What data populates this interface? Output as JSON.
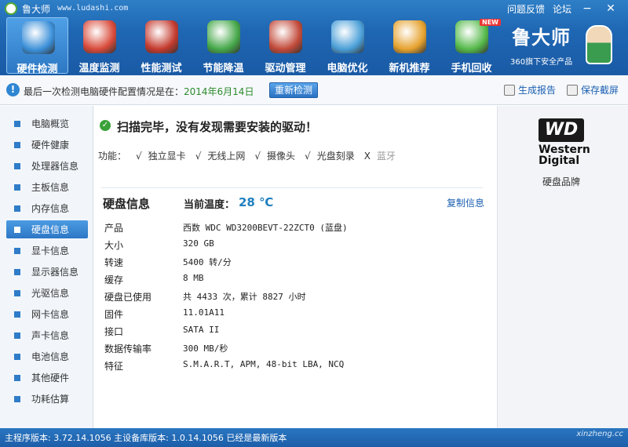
{
  "titlebar": {
    "app_title": "鲁大师",
    "site": "www.ludashi.com",
    "links": [
      "问题反馈",
      "论坛"
    ]
  },
  "toolbar": {
    "tools": [
      {
        "label": "硬件检测",
        "icon": "hardware-check-icon",
        "color": "#3a8fd8"
      },
      {
        "label": "温度监测",
        "icon": "thermometer-icon",
        "color": "#d84a3a"
      },
      {
        "label": "性能测试",
        "icon": "speedometer-icon",
        "color": "#c43a2e"
      },
      {
        "label": "节能降温",
        "icon": "clover-icon",
        "color": "#46a84a"
      },
      {
        "label": "驱动管理",
        "icon": "driver-box-icon",
        "color": "#c24a3a"
      },
      {
        "label": "电脑优化",
        "icon": "monitor-optimize-icon",
        "color": "#4a9fd8"
      },
      {
        "label": "新机推荐",
        "icon": "ribbon-award-icon",
        "color": "#e6a22e"
      },
      {
        "label": "手机回收",
        "icon": "phone-recycle-icon",
        "color": "#55b94a",
        "badge": "NEW"
      }
    ],
    "active_index": 0
  },
  "brand": {
    "name": "鲁大师",
    "subtitle": "360旗下安全产品"
  },
  "infobar": {
    "text": "最后一次检测电脑硬件配置情况是在：",
    "date": "2014年6月14日",
    "recheck_label": "重新检测",
    "report_label": "生成报告",
    "screenshot_label": "保存截屏"
  },
  "sidebar": {
    "items": [
      {
        "label": "电脑概览"
      },
      {
        "label": "硬件健康"
      },
      {
        "label": "处理器信息"
      },
      {
        "label": "主板信息"
      },
      {
        "label": "内存信息"
      },
      {
        "label": "硬盘信息"
      },
      {
        "label": "显卡信息"
      },
      {
        "label": "显示器信息"
      },
      {
        "label": "光驱信息"
      },
      {
        "label": "网卡信息"
      },
      {
        "label": "声卡信息"
      },
      {
        "label": "电池信息"
      },
      {
        "label": "其他硬件"
      },
      {
        "label": "功耗估算"
      }
    ],
    "active_index": 5
  },
  "main": {
    "scan_status": "扫描完毕，没有发现需要安装的驱动！",
    "features_label": "功能：",
    "features": [
      {
        "mark": "√",
        "label": "独立显卡",
        "enabled": true
      },
      {
        "mark": "√",
        "label": "无线上网",
        "enabled": true
      },
      {
        "mark": "√",
        "label": "摄像头",
        "enabled": true
      },
      {
        "mark": "√",
        "label": "光盘刻录",
        "enabled": true
      },
      {
        "mark": "X",
        "label": "蓝牙",
        "enabled": false
      }
    ],
    "section_title": "硬盘信息",
    "temp_label": "当前温度：",
    "temp_value": "28 ℃",
    "copy_label": "复制信息",
    "rows": [
      {
        "key": "产品",
        "value": "西数 WDC WD3200BEVT-22ZCT0 (蓝盘)"
      },
      {
        "key": "大小",
        "value": "320 GB"
      },
      {
        "key": "转速",
        "value": "5400 转/分"
      },
      {
        "key": "缓存",
        "value": "8 MB"
      },
      {
        "key": "硬盘已使用",
        "value": "共 4433 次，累计 8827 小时"
      },
      {
        "key": "固件",
        "value": "11.01A11"
      },
      {
        "key": "接口",
        "value": "SATA II"
      },
      {
        "key": "数据传输率",
        "value": "300 MB/秒"
      },
      {
        "key": "特征",
        "value": "S.M.A.R.T,  APM,  48-bit LBA,  NCQ"
      }
    ]
  },
  "right_panel": {
    "logo_badge": "WD",
    "logo_text_1": "Western",
    "logo_text_2": "Digital",
    "caption": "硬盘品牌"
  },
  "statusbar": {
    "text": "主程序版本: 3.72.14.1056   主设备库版本: 1.0.14.1056   已经是最新版本",
    "watermark": "xinzheng.cc"
  }
}
